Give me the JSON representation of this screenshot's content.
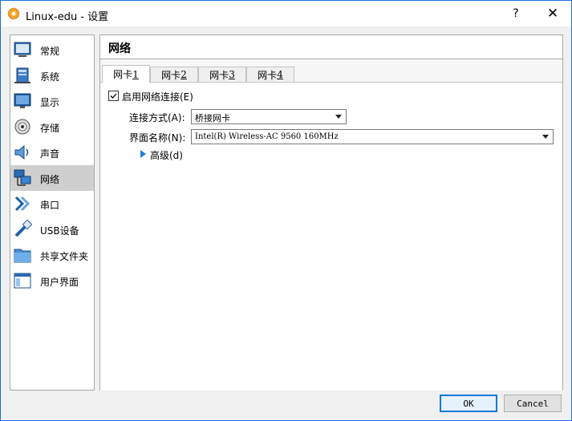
{
  "window": {
    "title": "Linux-edu - 设置",
    "help_glyph": "?",
    "close_glyph": "✕"
  },
  "sidebar": {
    "items": [
      {
        "label": "常规",
        "icon": "general-icon"
      },
      {
        "label": "系统",
        "icon": "system-icon"
      },
      {
        "label": "显示",
        "icon": "display-icon"
      },
      {
        "label": "存储",
        "icon": "storage-icon"
      },
      {
        "label": "声音",
        "icon": "audio-icon"
      },
      {
        "label": "网络",
        "icon": "network-icon",
        "selected": true
      },
      {
        "label": "串口",
        "icon": "serial-port-icon"
      },
      {
        "label": "USB设备",
        "icon": "usb-icon"
      },
      {
        "label": "共享文件夹",
        "icon": "shared-folder-icon"
      },
      {
        "label": "用户界面",
        "icon": "user-interface-icon"
      }
    ]
  },
  "main": {
    "section_title": "网络",
    "tabs": [
      {
        "text": "网卡 ",
        "mnemonic": "1",
        "active": true
      },
      {
        "text": "网卡 ",
        "mnemonic": "2"
      },
      {
        "text": "网卡 ",
        "mnemonic": "3"
      },
      {
        "text": "网卡 ",
        "mnemonic": "4"
      }
    ],
    "enable_checkbox": {
      "label": "启用网络连接(E)",
      "checked": true
    },
    "attached_to": {
      "label": "连接方式(A):",
      "value": "桥接网卡"
    },
    "interface_name": {
      "label": "界面名称(N):",
      "value": "Intel(R) Wireless-AC 9560 160MHz"
    },
    "advanced": {
      "label": "高级(d)"
    }
  },
  "buttons": {
    "ok": "OK",
    "cancel": "Cancel"
  },
  "colors": {
    "window_border": "#1f6fd6",
    "accent": "#1e7fd8",
    "selected_item_bg": "#cfcfcf"
  }
}
